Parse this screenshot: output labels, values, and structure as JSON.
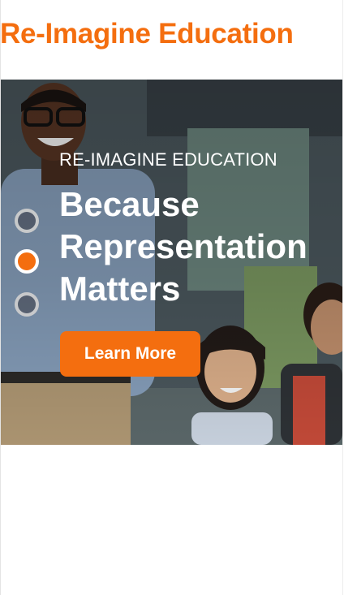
{
  "header": {
    "title": "Re-Imagine Education"
  },
  "hero": {
    "eyebrow": "RE-IMAGINE EDUCATION",
    "headline_lines": [
      "Because",
      "Representation",
      "Matters"
    ],
    "cta_label": "Learn More",
    "slides_total": 3,
    "active_slide": 2
  },
  "colors": {
    "accent": "#f46e0f",
    "text_on_dark": "#ffffff"
  }
}
